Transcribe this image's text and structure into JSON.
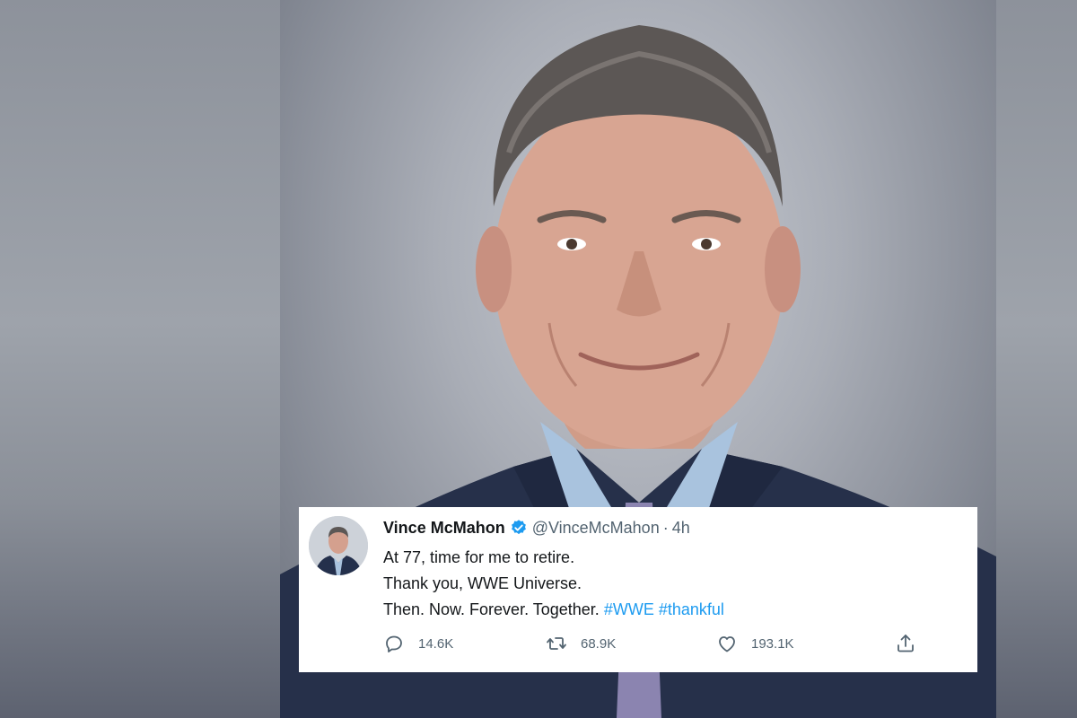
{
  "tweet": {
    "display_name": "Vince McMahon",
    "handle": "@VinceMcMahon",
    "separator": "·",
    "time": "4h",
    "lines": {
      "line1": "At 77, time for me to retire.",
      "line2": "Thank you, WWE Universe.",
      "line3_text": "Then. Now. Forever. Together.",
      "hashtag1": "#WWE",
      "hashtag2": "#thankful"
    },
    "stats": {
      "replies": "14.6K",
      "retweets": "68.9K",
      "likes": "193.1K"
    },
    "icons": [
      "verified-badge-icon",
      "reply-icon",
      "retweet-icon",
      "like-icon",
      "share-icon"
    ]
  },
  "colors": {
    "link": "#1d9bf0",
    "verified": "#1d9bf0",
    "text_primary": "#14171a",
    "text_secondary": "#536471"
  }
}
